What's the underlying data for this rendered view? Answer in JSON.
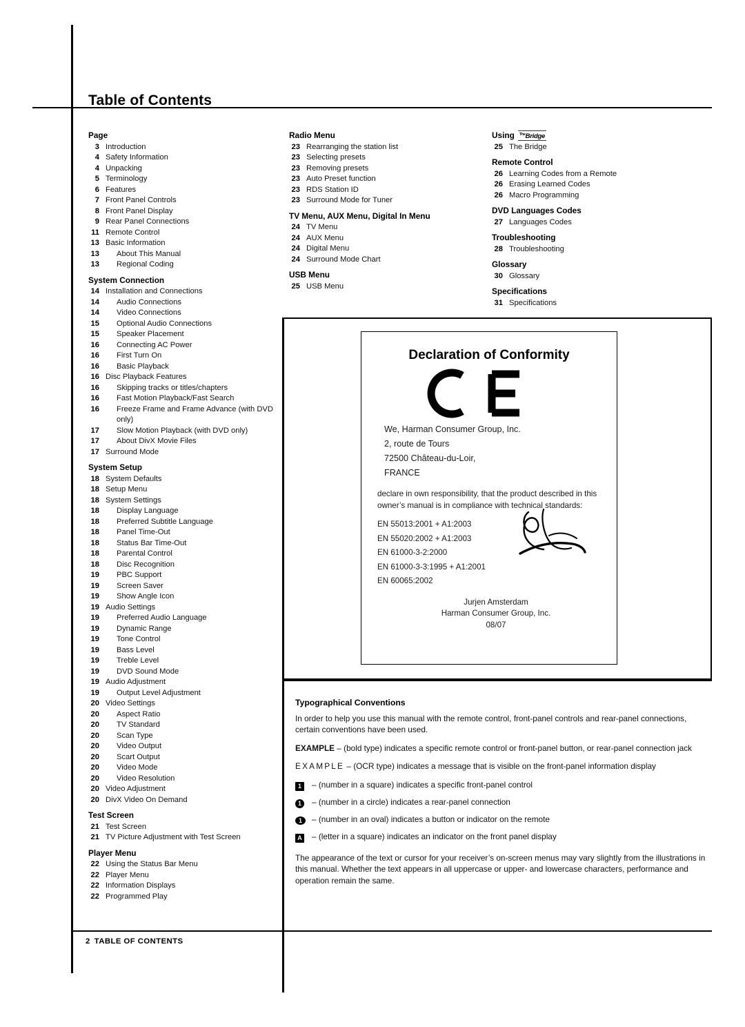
{
  "document": {
    "title": "Table of Contents",
    "footer_page": "2",
    "footer_label": "TABLE OF CONTENTS"
  },
  "toc": {
    "column1": [
      {
        "type": "head",
        "label": "Page"
      },
      {
        "type": "item",
        "page": "3",
        "label": "Introduction",
        "indent": false
      },
      {
        "type": "item",
        "page": "4",
        "label": "Safety Information",
        "indent": false
      },
      {
        "type": "item",
        "page": "4",
        "label": "Unpacking",
        "indent": false
      },
      {
        "type": "item",
        "page": "5",
        "label": "Terminology",
        "indent": false
      },
      {
        "type": "item",
        "page": "6",
        "label": "Features",
        "indent": false
      },
      {
        "type": "item",
        "page": "7",
        "label": "Front Panel Controls",
        "indent": false
      },
      {
        "type": "item",
        "page": "8",
        "label": "Front Panel Display",
        "indent": false
      },
      {
        "type": "item",
        "page": "9",
        "label": "Rear Panel Connections",
        "indent": false
      },
      {
        "type": "item",
        "page": "11",
        "label": "Remote Control",
        "indent": false
      },
      {
        "type": "item",
        "page": "13",
        "label": "Basic Information",
        "indent": false
      },
      {
        "type": "item",
        "page": "13",
        "label": "About This Manual",
        "indent": true
      },
      {
        "type": "item",
        "page": "13",
        "label": "Regional Coding",
        "indent": true
      },
      {
        "type": "head",
        "label": "System Connection"
      },
      {
        "type": "item",
        "page": "14",
        "label": "Installation and Connections",
        "indent": false
      },
      {
        "type": "item",
        "page": "14",
        "label": "Audio Connections",
        "indent": true
      },
      {
        "type": "item",
        "page": "14",
        "label": "Video Connections",
        "indent": true
      },
      {
        "type": "item",
        "page": "15",
        "label": "Optional Audio Connections",
        "indent": true
      },
      {
        "type": "item",
        "page": "15",
        "label": "Speaker Placement",
        "indent": true
      },
      {
        "type": "item",
        "page": "16",
        "label": "Connecting AC Power",
        "indent": true
      },
      {
        "type": "item",
        "page": "16",
        "label": "First Turn On",
        "indent": true
      },
      {
        "type": "item",
        "page": "16",
        "label": "Basic Playback",
        "indent": true
      },
      {
        "type": "item",
        "page": "16",
        "label": "Disc Playback Features",
        "indent": false
      },
      {
        "type": "item",
        "page": "16",
        "label": "Skipping tracks or titles/chapters",
        "indent": true
      },
      {
        "type": "item",
        "page": "16",
        "label": "Fast Motion Playback/Fast Search",
        "indent": true
      },
      {
        "type": "item",
        "page": "16",
        "label": "Freeze Frame and Frame Advance (with DVD only)",
        "indent": true
      },
      {
        "type": "item",
        "page": "17",
        "label": "Slow Motion Playback (with DVD only)",
        "indent": true
      },
      {
        "type": "item",
        "page": "17",
        "label": "About DivX Movie Files",
        "indent": true
      },
      {
        "type": "item",
        "page": "17",
        "label": "Surround Mode",
        "indent": false
      },
      {
        "type": "head",
        "label": "System Setup"
      },
      {
        "type": "item",
        "page": "18",
        "label": "System Defaults",
        "indent": false
      },
      {
        "type": "item",
        "page": "18",
        "label": "Setup Menu",
        "indent": false
      },
      {
        "type": "item",
        "page": "18",
        "label": "System Settings",
        "indent": false
      },
      {
        "type": "item",
        "page": "18",
        "label": "Display Language",
        "indent": true
      },
      {
        "type": "item",
        "page": "18",
        "label": "Preferred Subtitle Language",
        "indent": true
      },
      {
        "type": "item",
        "page": "18",
        "label": "Panel Time-Out",
        "indent": true
      },
      {
        "type": "item",
        "page": "18",
        "label": "Status Bar Time-Out",
        "indent": true
      },
      {
        "type": "item",
        "page": "18",
        "label": "Parental Control",
        "indent": true
      },
      {
        "type": "item",
        "page": "18",
        "label": "Disc Recognition",
        "indent": true
      },
      {
        "type": "item",
        "page": "19",
        "label": "PBC Support",
        "indent": true
      },
      {
        "type": "item",
        "page": "19",
        "label": "Screen Saver",
        "indent": true
      },
      {
        "type": "item",
        "page": "19",
        "label": "Show Angle Icon",
        "indent": true
      },
      {
        "type": "item",
        "page": "19",
        "label": "Audio Settings",
        "indent": false
      },
      {
        "type": "item",
        "page": "19",
        "label": "Preferred Audio Language",
        "indent": true
      },
      {
        "type": "item",
        "page": "19",
        "label": "Dynamic Range",
        "indent": true
      },
      {
        "type": "item",
        "page": "19",
        "label": "Tone Control",
        "indent": true
      },
      {
        "type": "item",
        "page": "19",
        "label": "Bass Level",
        "indent": true
      },
      {
        "type": "item",
        "page": "19",
        "label": "Treble Level",
        "indent": true
      },
      {
        "type": "item",
        "page": "19",
        "label": "DVD Sound Mode",
        "indent": true
      },
      {
        "type": "item",
        "page": "19",
        "label": "Audio Adjustment",
        "indent": false
      },
      {
        "type": "item",
        "page": "19",
        "label": "Output Level Adjustment",
        "indent": true
      },
      {
        "type": "item",
        "page": "20",
        "label": "Video Settings",
        "indent": false
      },
      {
        "type": "item",
        "page": "20",
        "label": "Aspect Ratio",
        "indent": true
      },
      {
        "type": "item",
        "page": "20",
        "label": "TV Standard",
        "indent": true
      },
      {
        "type": "item",
        "page": "20",
        "label": "Scan Type",
        "indent": true
      },
      {
        "type": "item",
        "page": "20",
        "label": "Video Output",
        "indent": true
      },
      {
        "type": "item",
        "page": "20",
        "label": "Scart Output",
        "indent": true
      },
      {
        "type": "item",
        "page": "20",
        "label": "Video Mode",
        "indent": true
      },
      {
        "type": "item",
        "page": "20",
        "label": "Video Resolution",
        "indent": true
      },
      {
        "type": "item",
        "page": "20",
        "label": "Video Adjustment",
        "indent": false
      },
      {
        "type": "item",
        "page": "20",
        "label": "DivX Video On Demand",
        "indent": false
      },
      {
        "type": "head",
        "label": "Test Screen"
      },
      {
        "type": "item",
        "page": "21",
        "label": "Test Screen",
        "indent": false
      },
      {
        "type": "item",
        "page": "21",
        "label": "TV Picture Adjustment with Test Screen",
        "indent": false
      },
      {
        "type": "head",
        "label": "Player Menu"
      },
      {
        "type": "item",
        "page": "22",
        "label": "Using the Status Bar Menu",
        "indent": false
      },
      {
        "type": "item",
        "page": "22",
        "label": "Player Menu",
        "indent": false
      },
      {
        "type": "item",
        "page": "22",
        "label": "Information Displays",
        "indent": false
      },
      {
        "type": "item",
        "page": "22",
        "label": "Programmed Play",
        "indent": false
      }
    ],
    "column2": [
      {
        "type": "head",
        "label": "Radio Menu"
      },
      {
        "type": "item",
        "page": "23",
        "label": "Rearranging the station list",
        "indent": false
      },
      {
        "type": "item",
        "page": "23",
        "label": "Selecting presets",
        "indent": false
      },
      {
        "type": "item",
        "page": "23",
        "label": "Removing presets",
        "indent": false
      },
      {
        "type": "item",
        "page": "23",
        "label": "Auto Preset function",
        "indent": false
      },
      {
        "type": "item",
        "page": "23",
        "label": "RDS Station ID",
        "indent": false
      },
      {
        "type": "item",
        "page": "23",
        "label": "Surround Mode for Tuner",
        "indent": false
      },
      {
        "type": "head",
        "label": "TV Menu, AUX Menu, Digital In Menu"
      },
      {
        "type": "item",
        "page": "24",
        "label": "TV Menu",
        "indent": false
      },
      {
        "type": "item",
        "page": "24",
        "label": "AUX Menu",
        "indent": false
      },
      {
        "type": "item",
        "page": "24",
        "label": "Digital Menu",
        "indent": false
      },
      {
        "type": "item",
        "page": "24",
        "label": "Surround Mode Chart",
        "indent": false
      },
      {
        "type": "head",
        "label": "USB Menu"
      },
      {
        "type": "item",
        "page": "25",
        "label": "USB Menu",
        "indent": false
      }
    ],
    "column3": [
      {
        "type": "head-bridge",
        "label": "Using",
        "logo": "Bridge",
        "logo_sup": "The"
      },
      {
        "type": "item",
        "page": "25",
        "label": "The Bridge",
        "indent": false
      },
      {
        "type": "head",
        "label": "Remote Control"
      },
      {
        "type": "item",
        "page": "26",
        "label": "Learning Codes from a Remote",
        "indent": false
      },
      {
        "type": "item",
        "page": "26",
        "label": "Erasing Learned Codes",
        "indent": false
      },
      {
        "type": "item",
        "page": "26",
        "label": "Macro Programming",
        "indent": false
      },
      {
        "type": "head",
        "label": "DVD Languages Codes"
      },
      {
        "type": "item",
        "page": "27",
        "label": "Languages Codes",
        "indent": false
      },
      {
        "type": "head",
        "label": "Troubleshooting"
      },
      {
        "type": "item",
        "page": "28",
        "label": "Troubleshooting",
        "indent": false
      },
      {
        "type": "head",
        "label": "Glossary"
      },
      {
        "type": "item",
        "page": "30",
        "label": "Glossary",
        "indent": false
      },
      {
        "type": "head",
        "label": "Specifications"
      },
      {
        "type": "item",
        "page": "31",
        "label": "Specifications",
        "indent": false
      }
    ]
  },
  "declaration": {
    "title": "Declaration of Conformity",
    "ce_mark": "CE",
    "company_line1": "We, Harman Consumer Group, Inc.",
    "address_line1": "2, route de Tours",
    "address_line2": "72500 Château-du-Loir,",
    "address_line3": "FRANCE",
    "body": "declare in own responsibility, that the product described in this owner’s manual is in compliance with technical standards:",
    "standards": [
      "EN 55013:2001 + A1:2003",
      "EN 55020:2002 + A1:2003",
      "EN 61000-3-2:2000",
      "EN 61000-3-3:1995 + A1:2001",
      "EN 60065:2002"
    ],
    "signer_name": "Jurjen Amsterdam",
    "signer_company": "Harman Consumer Group, Inc.",
    "signer_date": "08/07"
  },
  "typographical": {
    "heading": "Typographical Conventions",
    "intro": "In order to help you use this manual with the remote control, front-panel controls and rear-panel connections, certain conventions have been used.",
    "example_bold_label": "EXAMPLE",
    "example_bold_text": " – (bold type) indicates a specific remote control or front-panel button, or rear-panel connection jack",
    "example_ocr_label": "EXAMPLE",
    "example_ocr_text": " – (OCR type) indicates a message that is visible on the front-panel information display",
    "legend": [
      {
        "glyph": "1",
        "shape": "square",
        "text": "– (number in a square) indicates a specific front-panel control"
      },
      {
        "glyph": "1",
        "shape": "circle",
        "text": "– (number in a circle) indicates a rear-panel connection"
      },
      {
        "glyph": "1",
        "shape": "oval",
        "text": "– (number in an oval) indicates a button or indicator on the remote"
      },
      {
        "glyph": "A",
        "shape": "square",
        "text": "– (letter in a square) indicates an indicator on the front panel display"
      }
    ],
    "closing": "The appearance of the text or cursor for your receiver’s on-screen menus may vary slightly from the illustrations in this manual. Whether the text appears in all uppercase or upper- and lowercase characters, performance and operation remain the same."
  }
}
